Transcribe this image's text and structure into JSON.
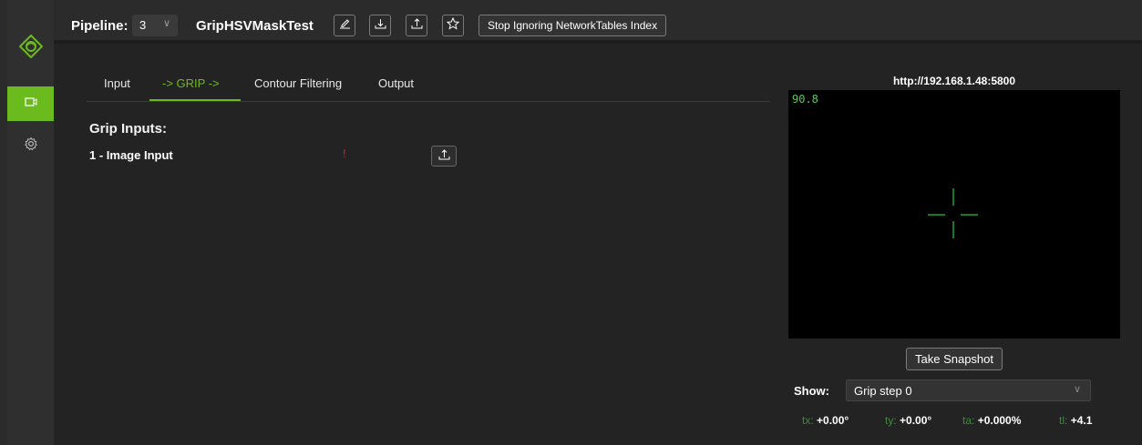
{
  "header": {
    "pipeline_label": "Pipeline:",
    "pipeline_index": "3",
    "pipeline_name": "GripHSVMaskTest",
    "stop_ignoring_label": "Stop Ignoring NetworkTables Index",
    "icons": [
      "edit-icon",
      "download-icon",
      "upload-icon",
      "star-icon"
    ]
  },
  "sidebar": {
    "items": [
      {
        "name": "camera-icon",
        "active": true
      },
      {
        "name": "settings-icon",
        "active": false
      }
    ],
    "accent": "#6cbb1e"
  },
  "tabs": [
    {
      "label": "Input",
      "active": false
    },
    {
      "label": "-> GRIP ->",
      "active": true
    },
    {
      "label": "Contour Filtering",
      "active": false
    },
    {
      "label": "Output",
      "active": false
    }
  ],
  "grip": {
    "title": "Grip Inputs:",
    "inputs": [
      {
        "label": "1 - Image Input",
        "warning": "!"
      }
    ]
  },
  "stream": {
    "url": "http://192.168.1.48:5800",
    "fps": "90.8",
    "snapshot_label": "Take Snapshot",
    "show_label": "Show:",
    "show_value": "Grip step 0"
  },
  "targets": {
    "tx_label": "tx:",
    "tx_value": "+0.00°",
    "ty_label": "ty:",
    "ty_value": "+0.00°",
    "ta_label": "ta:",
    "ta_value": "+0.000%",
    "tl_label": "tl:",
    "tl_value": "+4.1"
  },
  "colors": {
    "accent": "#6cbb1e",
    "warning": "#c62828",
    "crosshair": "#1fa32b"
  }
}
